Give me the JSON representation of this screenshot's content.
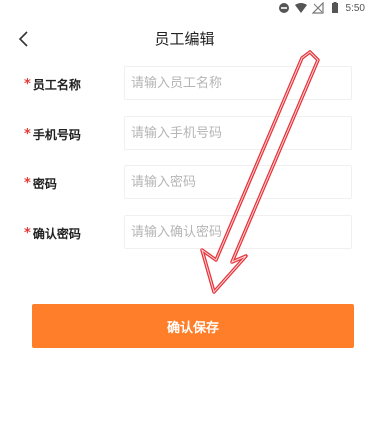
{
  "status_bar": {
    "time": "5:50"
  },
  "header": {
    "title": "员工编辑"
  },
  "form": {
    "required_marker": "*",
    "fields": [
      {
        "label": "员工名称",
        "placeholder": "请输入员工名称",
        "value": ""
      },
      {
        "label": "手机号码",
        "placeholder": "请输入手机号码",
        "value": ""
      },
      {
        "label": "密码",
        "placeholder": "请输入密码",
        "value": ""
      },
      {
        "label": "确认密码",
        "placeholder": "请输入确认密码",
        "value": ""
      }
    ]
  },
  "actions": {
    "confirm_label": "确认保存"
  },
  "colors": {
    "accent": "#ff7e2a",
    "required": "#e53935",
    "annotation_arrow": "#e8333a"
  },
  "icons": [
    "circle-icon",
    "wifi-icon",
    "signal-icon",
    "battery-icon",
    "back-chevron-icon"
  ]
}
